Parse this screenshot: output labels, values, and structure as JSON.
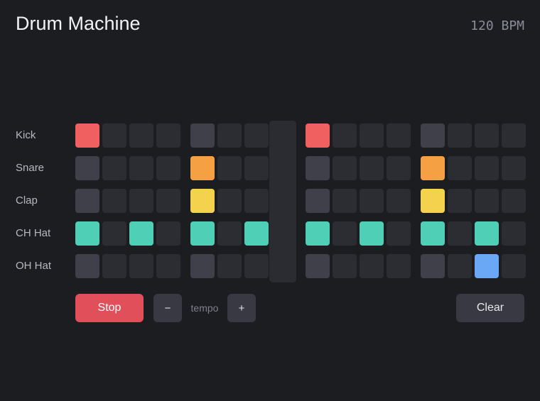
{
  "app": {
    "title": "Drum Machine",
    "bpm_display": "120 BPM"
  },
  "tracks": [
    {
      "name": "Kick",
      "color": "#f06060",
      "steps": [
        1,
        0,
        0,
        0,
        0,
        0,
        0,
        0,
        1,
        0,
        0,
        0,
        0,
        0,
        0,
        0
      ]
    },
    {
      "name": "Snare",
      "color": "#f5a042",
      "steps": [
        0,
        0,
        0,
        0,
        1,
        0,
        0,
        0,
        0,
        0,
        0,
        0,
        1,
        0,
        0,
        0
      ]
    },
    {
      "name": "Clap",
      "color": "#f4d24e",
      "steps": [
        0,
        0,
        0,
        0,
        1,
        0,
        0,
        0,
        0,
        0,
        0,
        0,
        1,
        0,
        0,
        0
      ]
    },
    {
      "name": "CH Hat",
      "color": "#4fcfb6",
      "steps": [
        1,
        0,
        1,
        0,
        1,
        0,
        1,
        0,
        1,
        0,
        1,
        0,
        1,
        0,
        1,
        0
      ]
    },
    {
      "name": "OH Hat",
      "color": "#6aa8f5",
      "steps": [
        0,
        0,
        0,
        0,
        0,
        0,
        0,
        0,
        0,
        0,
        0,
        0,
        0,
        0,
        1,
        0
      ]
    }
  ],
  "playhead_step": 7,
  "controls": {
    "stop_label": "Stop",
    "tempo_down_label": "−",
    "tempo_label": "tempo",
    "tempo_up_label": "+",
    "clear_label": "Clear"
  },
  "colors": {
    "background": "#1c1d21",
    "pad_off": "#2c2d33",
    "pad_beat": "#3f4049",
    "stop": "#e04f5a",
    "button": "#383943"
  }
}
